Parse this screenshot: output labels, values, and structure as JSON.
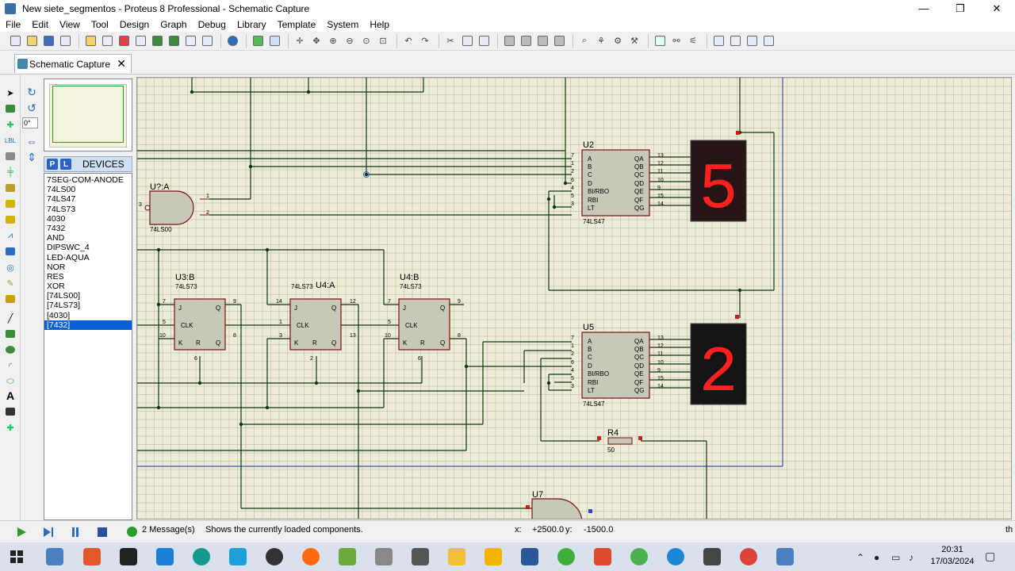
{
  "window": {
    "title": "New siete_segmentos - Proteus 8 Professional - Schematic Capture",
    "minimize": "—",
    "maximize": "❐",
    "close": "✕"
  },
  "menu": [
    "File",
    "Edit",
    "View",
    "Tool",
    "Design",
    "Graph",
    "Debug",
    "Library",
    "Template",
    "System",
    "Help"
  ],
  "tab": {
    "label": "Schematic Capture",
    "close": "✕"
  },
  "rotation": {
    "angle": "0°"
  },
  "devices": {
    "header": "DEVICES",
    "p_label": "P",
    "l_label": "L",
    "items": [
      "7SEG-COM-ANODE",
      "74LS00",
      "74LS47",
      "74LS73",
      "4030",
      "7432",
      "AND",
      "DIPSWC_4",
      "LED-AQUA",
      "NOR",
      "RES",
      "XOR",
      "[74LS00]",
      "[74LS73]",
      "[4030]",
      "[7432]"
    ],
    "selected_index": 15
  },
  "schematic": {
    "labels": {
      "u2": "U2",
      "u2_part": "74LS47",
      "u5": "U5",
      "u5_part": "74LS47",
      "gate": "U?:A",
      "gate_part": "74LS00",
      "ff1": "U3:B",
      "ff1_part": "74LS73",
      "ff2": "U4:A",
      "ff2_part": "74LS73",
      "ff3": "U4:B",
      "ff3_part": "74LS73",
      "r4": "R4",
      "r4_value": "50",
      "u7": "U7"
    },
    "decoder_inputs": [
      "A",
      "B",
      "C",
      "D",
      "BI/RBO",
      "RBI",
      "LT"
    ],
    "decoder_outputs": [
      "QA",
      "QB",
      "QC",
      "QD",
      "QE",
      "QF",
      "QG"
    ],
    "decoder_in_pins": [
      "7",
      "1",
      "2",
      "6",
      "4",
      "5",
      "3"
    ],
    "decoder_out_pins": [
      "13",
      "12",
      "11",
      "10",
      "9",
      "15",
      "14"
    ],
    "ff_pins": {
      "ff1": [
        "7",
        "5",
        "10",
        "9",
        "8",
        "6"
      ],
      "ff2": [
        "14",
        "1",
        "3",
        "12",
        "13",
        "2"
      ],
      "ff3": [
        "7",
        "5",
        "10",
        "9",
        "8",
        "6"
      ]
    },
    "gate_pins": [
      "1",
      "2",
      "3"
    ],
    "display_top_digit": "5",
    "display_bottom_digit": "2",
    "segment_color": "#ff2020"
  },
  "status": {
    "messages": "2 Message(s)",
    "hint": "Shows the currently loaded components.",
    "x_label": "x:",
    "x_value": "+2500.0",
    "y_label": "y:",
    "y_value": "-1500.0",
    "units": "th"
  },
  "taskbar": {
    "time": "20:31",
    "date": "17/03/2024"
  }
}
